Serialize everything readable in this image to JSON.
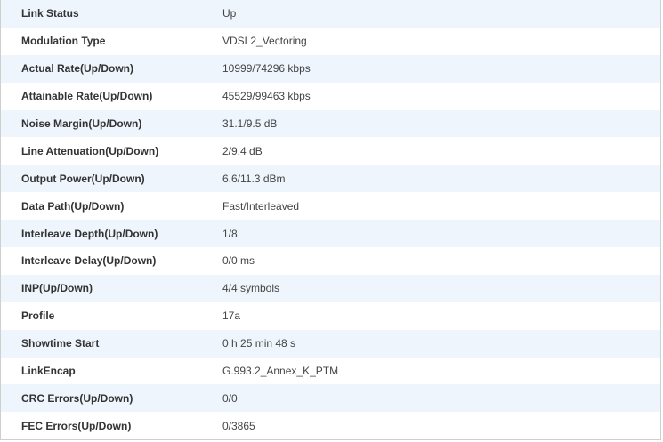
{
  "dsl_status": {
    "rows": [
      {
        "label": "Link Status",
        "value": "Up"
      },
      {
        "label": "Modulation Type",
        "value": "VDSL2_Vectoring"
      },
      {
        "label": "Actual Rate(Up/Down)",
        "value": "10999/74296 kbps"
      },
      {
        "label": "Attainable Rate(Up/Down)",
        "value": "45529/99463 kbps"
      },
      {
        "label": "Noise Margin(Up/Down)",
        "value": "31.1/9.5 dB"
      },
      {
        "label": "Line Attenuation(Up/Down)",
        "value": "2/9.4 dB"
      },
      {
        "label": "Output Power(Up/Down)",
        "value": "6.6/11.3 dBm"
      },
      {
        "label": "Data Path(Up/Down)",
        "value": "Fast/Interleaved"
      },
      {
        "label": "Interleave Depth(Up/Down)",
        "value": "1/8"
      },
      {
        "label": "Interleave Delay(Up/Down)",
        "value": "0/0 ms"
      },
      {
        "label": "INP(Up/Down)",
        "value": "4/4 symbols"
      },
      {
        "label": "Profile",
        "value": "17a"
      },
      {
        "label": "Showtime Start",
        "value": "0 h 25 min 48 s"
      },
      {
        "label": "LinkEncap",
        "value": "G.993.2_Annex_K_PTM"
      },
      {
        "label": "CRC Errors(Up/Down)",
        "value": "0/0"
      },
      {
        "label": "FEC Errors(Up/Down)",
        "value": "0/3865"
      }
    ]
  },
  "colors": {
    "stripe_row": "#eef5fc",
    "plain_row": "#ffffff",
    "border": "#cfcfcf",
    "text": "#333333"
  }
}
